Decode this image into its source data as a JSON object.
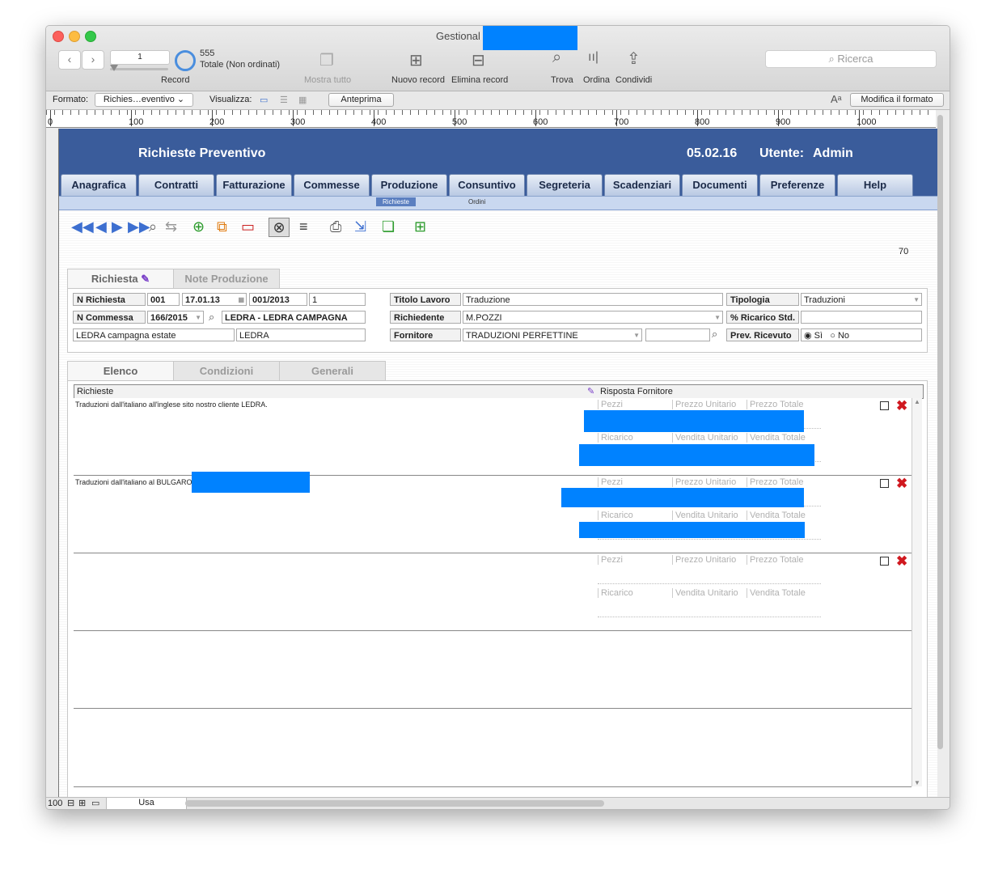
{
  "window": {
    "title": "Gestional"
  },
  "toolbar": {
    "record_current": "1",
    "record_total": "555",
    "record_sort": "Totale (Non ordinati)",
    "record_label": "Record",
    "show_all": "Mostra tutto",
    "new_record": "Nuovo record",
    "delete_record": "Elimina record",
    "find": "Trova",
    "sort": "Ordina",
    "share": "Condividi",
    "search_placeholder": "Ricerca"
  },
  "format_bar": {
    "format_label": "Formato:",
    "layout_value": "Richies…eventivo",
    "view_label": "Visualizza:",
    "preview": "Anteprima",
    "edit_layout": "Modifica il formato"
  },
  "ruler": {
    "marks": [
      "0",
      "100",
      "200",
      "300",
      "400",
      "500",
      "600",
      "700",
      "800",
      "900",
      "1000"
    ]
  },
  "header": {
    "title": "Richieste Preventivo",
    "date": "05.02.16",
    "user_label": "Utente:",
    "user": "Admin",
    "menu": [
      "Anagrafica",
      "Contratti",
      "Fatturazione",
      "Commesse",
      "Produzione",
      "Consuntivo",
      "Segreteria",
      "Scadenziari",
      "Documenti",
      "Preferenze",
      "Help"
    ],
    "submenu": [
      "Richieste",
      "Ordini"
    ]
  },
  "record_count": "70",
  "top_tabs": [
    "Richiesta",
    "Note Produzione"
  ],
  "form": {
    "n_richiesta_label": "N Richiesta",
    "n_richiesta": "001",
    "data": "17.01.13",
    "codice": "001/2013",
    "rev": "1",
    "n_commessa_label": "N Commessa",
    "n_commessa": "166/2015",
    "cliente": "LEDRA - LEDRA CAMPAGNA",
    "descr_commessa": "LEDRA campagna estate",
    "cliente_breve": "LEDRA",
    "titolo_label": "Titolo Lavoro",
    "titolo": "Traduzione",
    "richiedente_label": "Richiedente",
    "richiedente": "M.POZZI",
    "fornitore_label": "Fornitore",
    "fornitore": "TRADUZIONI PERFETTINE",
    "tipologia_label": "Tipologia",
    "tipologia": "Traduzioni",
    "ricarico_label": "% Ricarico Std.",
    "prev_label": "Prev. Ricevuto",
    "si": "Sì",
    "no": "No"
  },
  "sub_tabs": [
    "Elenco",
    "Condizioni",
    "Generali"
  ],
  "grid": {
    "col_richieste": "Richieste",
    "col_risposta": "Risposta Fornitore",
    "field_labels": [
      "Pezzi",
      "Prezzo Unitario",
      "Prezzo Totale",
      "Ricarico",
      "Vendita Unitario",
      "Vendita Totale"
    ],
    "rows": [
      {
        "text": "Traduzioni dall'italiano all'inglese sito nostro cliente LEDRA."
      },
      {
        "text": "Traduzioni dall'italiano al BULGARO"
      },
      {
        "text": ""
      }
    ]
  },
  "status": {
    "zoom": "100",
    "mode": "Usa"
  },
  "colors": {
    "header": "#3a5c9b",
    "accent": "#0082ff",
    "delete": "#d0181f"
  }
}
